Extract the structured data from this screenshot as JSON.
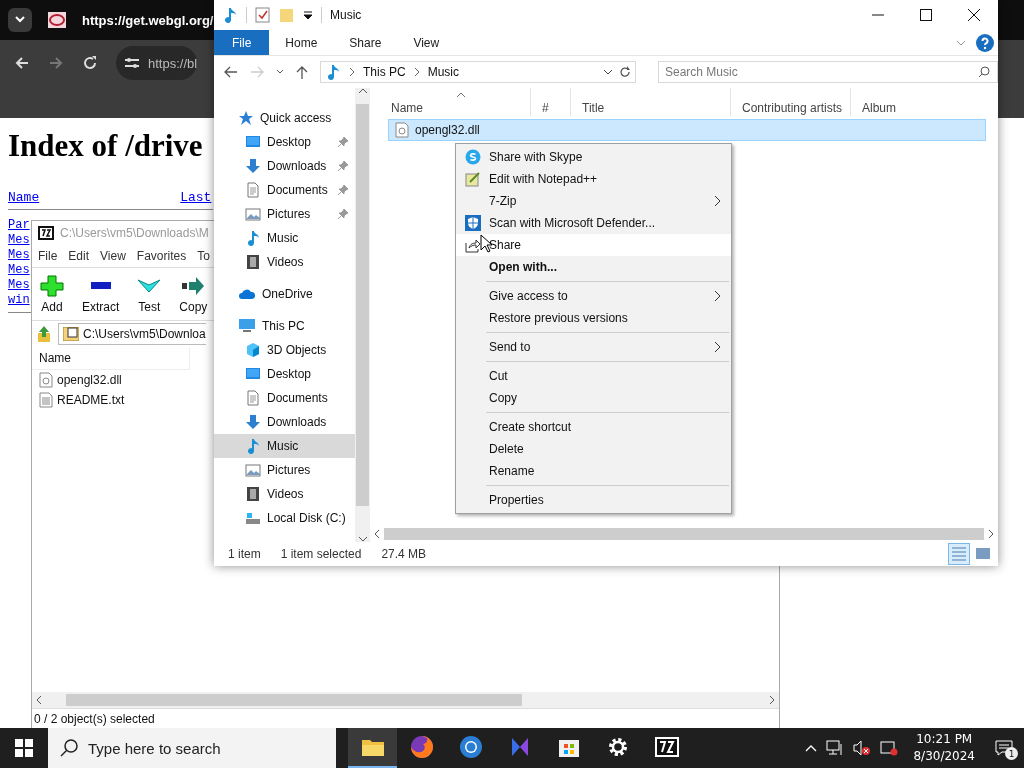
{
  "browser": {
    "tab_title": "https://get.webgl.org/",
    "address": "https://bl",
    "page": {
      "heading": "Index of /drive",
      "columns": [
        "Name",
        "Last"
      ],
      "links": [
        "Par",
        "Mes",
        "Mes",
        "Mes",
        "Mes",
        "win"
      ]
    }
  },
  "archive_window": {
    "title": "C:\\Users\\vm5\\Downloads\\M",
    "menu": [
      "File",
      "Edit",
      "View",
      "Favorites",
      "To"
    ],
    "toolbar": [
      {
        "kind": "add",
        "label": "Add"
      },
      {
        "kind": "extract",
        "label": "Extract"
      },
      {
        "kind": "test",
        "label": "Test"
      },
      {
        "kind": "copy",
        "label": "Copy"
      }
    ],
    "path": "C:\\Users\\vm5\\Downloa",
    "column": "Name",
    "files": [
      {
        "kind": "dll",
        "name": "opengl32.dll"
      },
      {
        "kind": "text",
        "name": "README.txt"
      }
    ],
    "status": "0 / 2 object(s) selected"
  },
  "explorer": {
    "title": "Music",
    "ribbon_tabs": [
      {
        "label": "File",
        "selected": true
      },
      {
        "label": "Home",
        "selected": false
      },
      {
        "label": "Share",
        "selected": false
      },
      {
        "label": "View",
        "selected": false
      }
    ],
    "breadcrumb": [
      "This PC",
      "Music"
    ],
    "search": {
      "placeholder": "Search Music"
    },
    "nav": [
      {
        "label": "Quick access",
        "kind": "star",
        "selected": false,
        "children": [
          {
            "label": "Desktop",
            "kind": "desktop",
            "pinned": true,
            "selected": false
          },
          {
            "label": "Downloads",
            "kind": "download",
            "pinned": true,
            "selected": false
          },
          {
            "label": "Documents",
            "kind": "document",
            "pinned": true,
            "selected": false
          },
          {
            "label": "Pictures",
            "kind": "pictures",
            "pinned": true,
            "selected": false
          },
          {
            "label": "Music",
            "kind": "music",
            "pinned": false,
            "selected": false
          },
          {
            "label": "Videos",
            "kind": "video",
            "pinned": false,
            "selected": false
          }
        ]
      },
      {
        "label": "OneDrive",
        "kind": "cloud",
        "selected": false
      },
      {
        "label": "This PC",
        "kind": "pc",
        "selected": false,
        "children": [
          {
            "label": "3D Objects",
            "kind": "cube",
            "pinned": false,
            "selected": false
          },
          {
            "label": "Desktop",
            "kind": "desktop",
            "pinned": false,
            "selected": false
          },
          {
            "label": "Documents",
            "kind": "document",
            "pinned": false,
            "selected": false
          },
          {
            "label": "Downloads",
            "kind": "download",
            "pinned": false,
            "selected": false
          },
          {
            "label": "Music",
            "kind": "music",
            "pinned": false,
            "selected": true
          },
          {
            "label": "Pictures",
            "kind": "pictures",
            "pinned": false,
            "selected": false
          },
          {
            "label": "Videos",
            "kind": "video",
            "pinned": false,
            "selected": false
          },
          {
            "label": "Local Disk (C:)",
            "kind": "disk",
            "pinned": false,
            "selected": false
          }
        ]
      }
    ],
    "columns": [
      {
        "label": "Name",
        "sorted": true
      },
      {
        "label": "#",
        "sorted": false
      },
      {
        "label": "Title",
        "sorted": false
      },
      {
        "label": "Contributing artists",
        "sorted": false
      },
      {
        "label": "Album",
        "sorted": false
      }
    ],
    "rows": [
      {
        "name": "opengl32.dll",
        "selected": true
      }
    ],
    "status": [
      "1 item",
      "1 item selected",
      "27.4 MB"
    ],
    "views": [
      {
        "kind": "details",
        "selected": true
      },
      {
        "kind": "tiles",
        "selected": false
      }
    ]
  },
  "context_menu": {
    "items": [
      {
        "kind": "skype",
        "label": "Share with Skype",
        "submenu": false,
        "default": false,
        "highlighted": false
      },
      {
        "kind": "notepad",
        "label": "Edit with Notepad++",
        "submenu": false,
        "default": false,
        "highlighted": false
      },
      {
        "kind": "plain",
        "label": "7-Zip",
        "submenu": true,
        "default": false,
        "highlighted": false
      },
      {
        "kind": "defender",
        "label": "Scan with Microsoft Defender...",
        "submenu": false,
        "default": false,
        "highlighted": false
      },
      {
        "kind": "share",
        "label": "Share",
        "submenu": false,
        "default": false,
        "highlighted": true
      },
      {
        "kind": "plain",
        "label": "Open with...",
        "submenu": false,
        "default": true,
        "highlighted": false
      },
      {
        "kind": "separator"
      },
      {
        "kind": "plain",
        "label": "Give access to",
        "submenu": true,
        "default": false,
        "highlighted": false
      },
      {
        "kind": "plain",
        "label": "Restore previous versions",
        "submenu": false,
        "default": false,
        "highlighted": false
      },
      {
        "kind": "separator"
      },
      {
        "kind": "plain",
        "label": "Send to",
        "submenu": true,
        "default": false,
        "highlighted": false
      },
      {
        "kind": "separator"
      },
      {
        "kind": "plain",
        "label": "Cut",
        "submenu": false,
        "default": false,
        "highlighted": false
      },
      {
        "kind": "plain",
        "label": "Copy",
        "submenu": false,
        "default": false,
        "highlighted": false
      },
      {
        "kind": "separator"
      },
      {
        "kind": "plain",
        "label": "Create shortcut",
        "submenu": false,
        "default": false,
        "highlighted": false
      },
      {
        "kind": "plain",
        "label": "Delete",
        "submenu": false,
        "default": false,
        "highlighted": false
      },
      {
        "kind": "plain",
        "label": "Rename",
        "submenu": false,
        "default": false,
        "highlighted": false
      },
      {
        "kind": "separator"
      },
      {
        "kind": "plain",
        "label": "Properties",
        "submenu": false,
        "default": false,
        "highlighted": false
      }
    ]
  },
  "taskbar": {
    "search": {
      "placeholder": "Type here to search"
    },
    "apps": [
      {
        "kind": "folder",
        "active": true
      },
      {
        "kind": "firefox",
        "active": false
      },
      {
        "kind": "browser",
        "active": false
      },
      {
        "kind": "copilot",
        "active": false
      },
      {
        "kind": "store",
        "active": false
      },
      {
        "kind": "settings",
        "active": false
      },
      {
        "kind": "archiver",
        "active": false
      }
    ],
    "time": "10:21 PM",
    "date": "8/30/2024",
    "notifications": "1"
  }
}
